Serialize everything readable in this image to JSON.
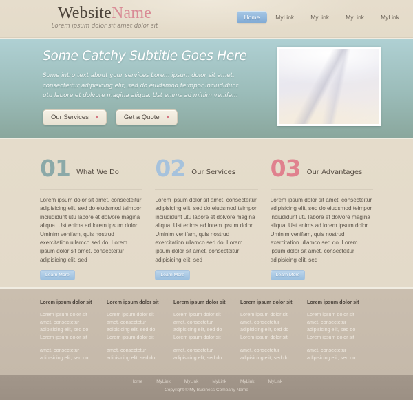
{
  "colors": {
    "brand_dark": "#4e453c",
    "brand_accent": "#d98b96",
    "hero_top": "#afd0d3",
    "hero_bottom": "#8aa79d",
    "num_01": "#8ba9a8",
    "num_02": "#a6c2dc",
    "num_03": "#e0818e",
    "nav_active": "#7fa9d4",
    "page_bg": "#e5dccb",
    "footer_cols_bg": "#c5b9aa",
    "footer_bar_bg": "#9c9084"
  },
  "header": {
    "brand": {
      "word1": "Website",
      "word2": "Name"
    },
    "tagline": "Lorem ipsum dolor sit amet dolor sit",
    "nav": [
      {
        "label": "Home",
        "active": true
      },
      {
        "label": "MyLink",
        "active": false
      },
      {
        "label": "MyLink",
        "active": false
      },
      {
        "label": "MyLink",
        "active": false
      },
      {
        "label": "MyLink",
        "active": false
      }
    ]
  },
  "hero": {
    "title": "Some Catchy Subtitle Goes Here",
    "intro": "Some intro text about your services Lorem ipsum dolor sit amet, consecteitur adipisicing elit, sed do eiudsmod teimpor inciudidunt utu labore et dolvore magina aliqua. Ust enims ad minim venifam",
    "buttons": [
      {
        "label": "Our Services",
        "icon": "arrow-right-icon"
      },
      {
        "label": "Get a Quote",
        "icon": "arrow-right-icon"
      }
    ],
    "image_alt": "abstract-wave-image"
  },
  "features": {
    "body_text": "Lorem ipsum dolor sit amet, consecteitur adipisicing elit, sed do eiudsmod teimpor inciudidunt utu labore et dolvore magina aliqua. Ust enims ad lorem ipsum dolor Uminim venifam, quis nostrud exercitation ullamco  sed do.  Lorem ipsum dolor sit amet, consecteitur adipisicing elit, sed",
    "learn_more": "Learn More",
    "columns": [
      {
        "number": "01",
        "label": "What We Do"
      },
      {
        "number": "02",
        "label": "Our Services"
      },
      {
        "number": "03",
        "label": "Our Advantages"
      }
    ]
  },
  "footer_columns": {
    "title": "Lorem ipsum dolor sit",
    "para1": "Lorem ipsum dolor sit amet, consectetur adipisicing elit, sed do Lorem ipsum dolor sit",
    "para2": "amet, consectetur adipisicing elit, sed do",
    "count": 5
  },
  "footer_bar": {
    "nav": [
      "Home",
      "MyLink",
      "MyLink",
      "MyLink",
      "MyLink",
      "MyLink"
    ],
    "copyright": "Copyright © My Business Company Name"
  }
}
